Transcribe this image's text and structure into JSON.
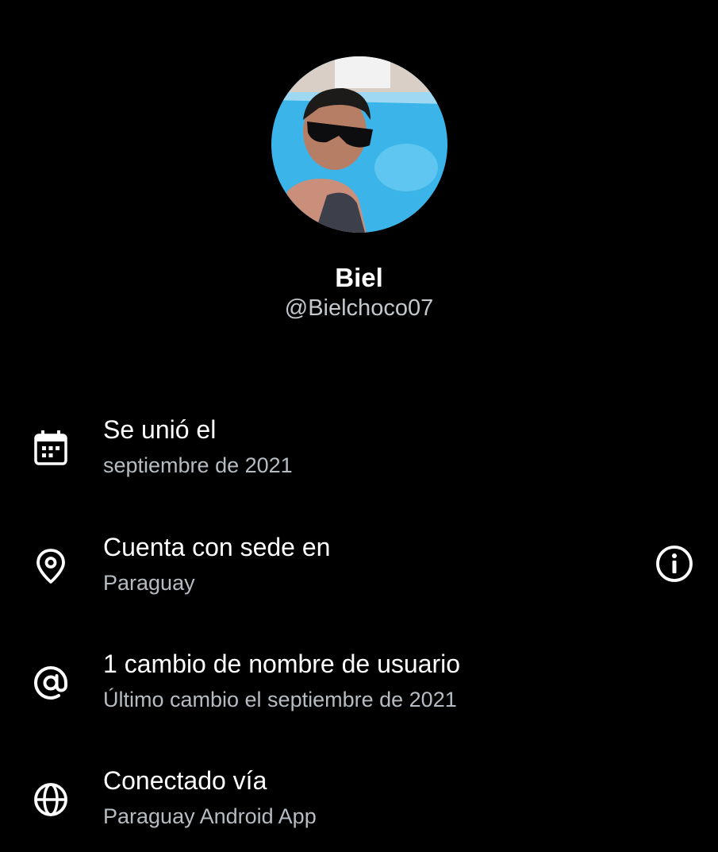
{
  "profile": {
    "display_name": "Biel",
    "handle": "@Bielchoco07"
  },
  "about": {
    "joined": {
      "icon": "calendar-icon",
      "title": "Se unió el",
      "value": "septiembre de 2021"
    },
    "location": {
      "icon": "location-pin-icon",
      "title": "Cuenta con sede en",
      "value": "Paraguay",
      "info_icon": "info-icon"
    },
    "username_changes": {
      "icon": "at-sign-icon",
      "title": "1 cambio de nombre de usuario",
      "value": "Último cambio el septiembre de 2021"
    },
    "connected_via": {
      "icon": "globe-icon",
      "title": "Conectado vía",
      "value": "Paraguay Android App"
    }
  },
  "colors": {
    "background": "#000000",
    "primary_text": "#ffffff",
    "secondary_text": "#b6bcc1"
  }
}
